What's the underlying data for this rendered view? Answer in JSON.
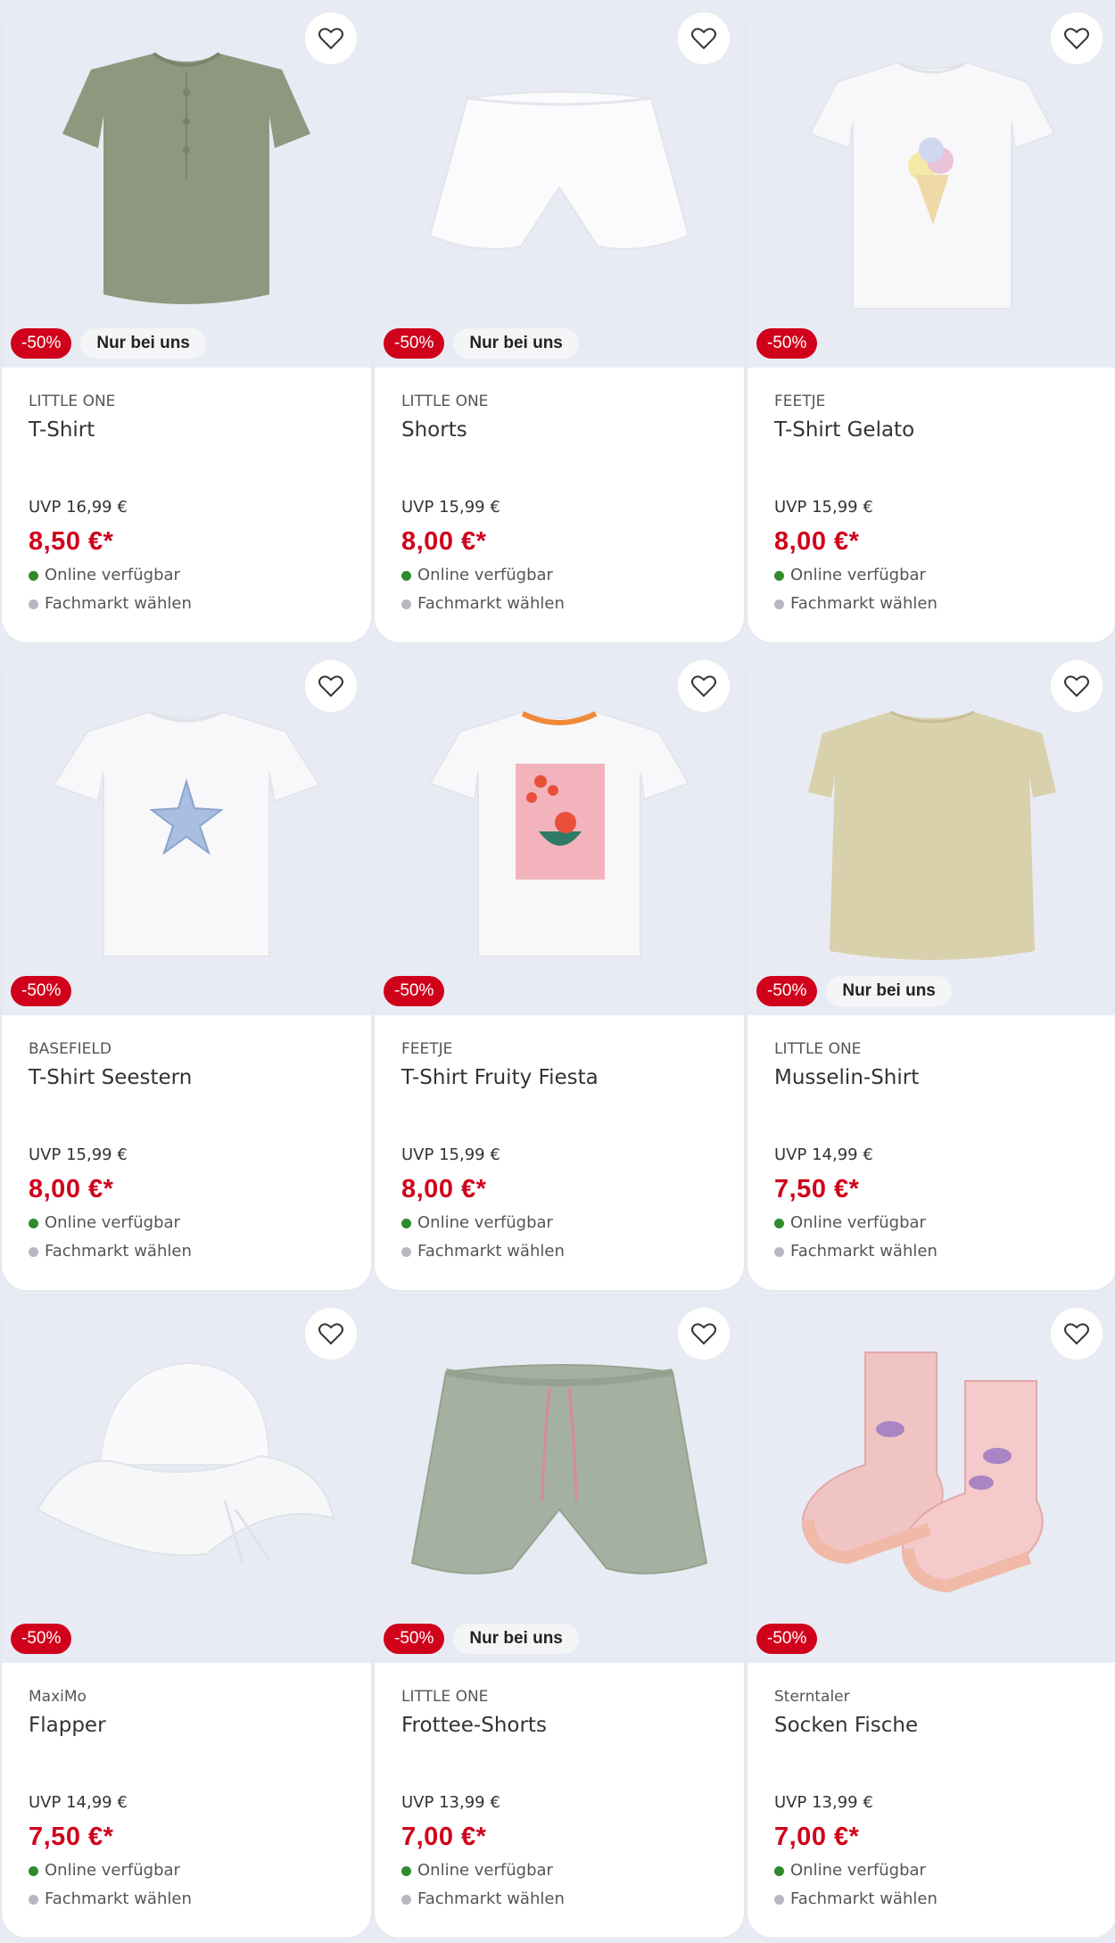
{
  "colors": {
    "discount_red": "#d0021b",
    "background": "#e8ebf3",
    "online_green": "#2e8b2e",
    "store_grey": "#b5b8bf"
  },
  "products": [
    {
      "brand": "LITTLE ONE",
      "name": "T-Shirt",
      "uvp": "UVP 16,99 €",
      "price": "8,50 €*",
      "discount": "-50%",
      "exclusive": "Nur bei uns",
      "online": "Online verfügbar",
      "store": "Fachmarkt wählen",
      "image": "olive-tshirt",
      "favorite_icon": "heart-icon"
    },
    {
      "brand": "LITTLE ONE",
      "name": "Shorts",
      "uvp": "UVP 15,99 €",
      "price": "8,00 €*",
      "discount": "-50%",
      "exclusive": "Nur bei uns",
      "online": "Online verfügbar",
      "store": "Fachmarkt wählen",
      "image": "white-shorts",
      "favorite_icon": "heart-icon"
    },
    {
      "brand": "FEETJE",
      "name": "T-Shirt Gelato",
      "uvp": "UVP 15,99 €",
      "price": "8,00 €*",
      "discount": "-50%",
      "exclusive": null,
      "online": "Online verfügbar",
      "store": "Fachmarkt wählen",
      "image": "white-tshirt-icecream",
      "favorite_icon": "heart-icon"
    },
    {
      "brand": "BASEFIELD",
      "name": "T-Shirt Seestern",
      "uvp": "UVP 15,99 €",
      "price": "8,00 €*",
      "discount": "-50%",
      "exclusive": null,
      "online": "Online verfügbar",
      "store": "Fachmarkt wählen",
      "image": "white-tshirt-starfish",
      "favorite_icon": "heart-icon"
    },
    {
      "brand": "FEETJE",
      "name": "T-Shirt Fruity Fiesta",
      "uvp": "UVP 15,99 €",
      "price": "8,00 €*",
      "discount": "-50%",
      "exclusive": null,
      "online": "Online verfügbar",
      "store": "Fachmarkt wählen",
      "image": "white-tshirt-fruity",
      "favorite_icon": "heart-icon"
    },
    {
      "brand": "LITTLE ONE",
      "name": "Musselin-Shirt",
      "uvp": "UVP 14,99 €",
      "price": "7,50 €*",
      "discount": "-50%",
      "exclusive": "Nur bei uns",
      "online": "Online verfügbar",
      "store": "Fachmarkt wählen",
      "image": "beige-shirt",
      "favorite_icon": "heart-icon"
    },
    {
      "brand": "MaxiMo",
      "name": "Flapper",
      "uvp": "UVP 14,99 €",
      "price": "7,50 €*",
      "discount": "-50%",
      "exclusive": null,
      "online": "Online verfügbar",
      "store": "Fachmarkt wählen",
      "image": "white-sun-hat",
      "favorite_icon": "heart-icon"
    },
    {
      "brand": "LITTLE ONE",
      "name": "Frottee-Shorts",
      "uvp": "UVP 13,99 €",
      "price": "7,00 €*",
      "discount": "-50%",
      "exclusive": "Nur bei uns",
      "online": "Online verfügbar",
      "store": "Fachmarkt wählen",
      "image": "green-ruffle-shorts",
      "favorite_icon": "heart-icon"
    },
    {
      "brand": "Sterntaler",
      "name": "Socken Fische",
      "uvp": "UVP 13,99 €",
      "price": "7,00 €*",
      "discount": "-50%",
      "exclusive": null,
      "online": "Online verfügbar",
      "store": "Fachmarkt wählen",
      "image": "pink-fish-socks",
      "favorite_icon": "heart-icon"
    }
  ]
}
